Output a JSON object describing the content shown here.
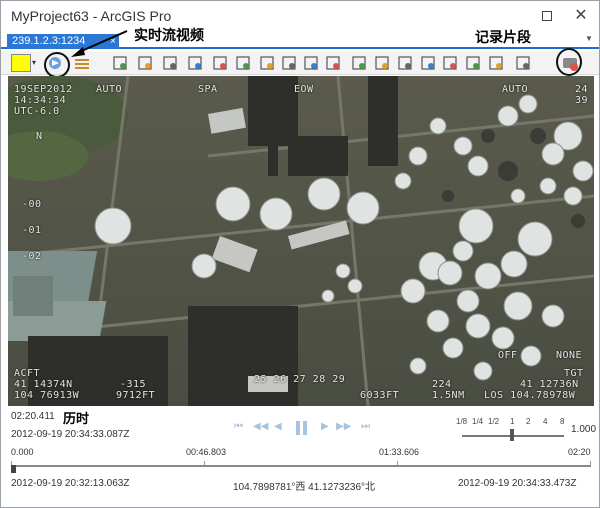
{
  "window": {
    "title": "MyProject63 - ArcGIS Pro",
    "restore_icon": "restore-icon",
    "close_symbol": "✕"
  },
  "tab": {
    "label": "239.1.2.3:1234",
    "close_symbol": "×",
    "dropdown_symbol": "▼"
  },
  "annotations": {
    "live_stream": "实时流视频",
    "record_clip": "记录片段",
    "elapsed": "历时"
  },
  "toolbar": {
    "swatch_color": "#ffff00",
    "swatch_dropdown": "▾",
    "buttons": [
      "live-stream-icon",
      "menu-icon",
      "bookmark-icon",
      "zoom-to-frame-icon",
      "zoom-to-footprint-icon",
      "zoom-to-sensor-icon",
      "north-arrow-icon",
      "add-point-icon",
      "delete-graphic-icon",
      "edit-graphic-icon",
      "measure-icon",
      "clip-icon",
      "table-icon",
      "frame-icon",
      "image-icon",
      "export-icon",
      "camera-icon",
      "video-icon",
      "record-icon",
      "stop-record-icon",
      "record-clip-icon"
    ]
  },
  "video": {
    "osd": {
      "date": "19SEP2012",
      "time": "14:34:34",
      "utc": "UTC-6.0",
      "mode": "AUTO",
      "spa": "SPA",
      "eow": "EOW",
      "auto_right": "AUTO",
      "gain": "24",
      "zoom": "39",
      "north": "N",
      "scale_marks": [
        "-00",
        "-01",
        "-02"
      ],
      "acft": "ACFT",
      "acft_lat": "41 14374N",
      "acft_lon": "104 76913W",
      "heading": "-315",
      "alt_ft": "9712FT",
      "center_coords": "25 26 27 28 29",
      "center_alt": "6033FT",
      "range_val": "224",
      "range_unit": "1.5NM",
      "tgt": "TGT",
      "tgt_lat": "41 12736N",
      "tgt_los": "LOS 104.78978W",
      "off": "OFF",
      "none": "NONE"
    }
  },
  "playback": {
    "elapsed": "02:20.411",
    "current_datetime": "2012-09-19 20:34:33.087Z",
    "speed_labels": [
      "1/8",
      "1/4",
      "1/2",
      "1",
      "2",
      "4",
      "8"
    ],
    "speed_value": "1.000",
    "speed_fraction": 0.5,
    "timeline_start": "0.000",
    "timeline_mark1": "00:46.803",
    "timeline_mark2": "01:33.606",
    "timeline_end": "02:20",
    "timeline_fraction": 0.0,
    "start_datetime": "2012-09-19 20:32:13.063Z",
    "coordinates": "104.7898781°西 41.1273236°北",
    "end_datetime": "2012-09-19 20:34:33.473Z"
  },
  "colors": {
    "accent": "#2b77d4",
    "control_icon": "#a9c2dd"
  }
}
